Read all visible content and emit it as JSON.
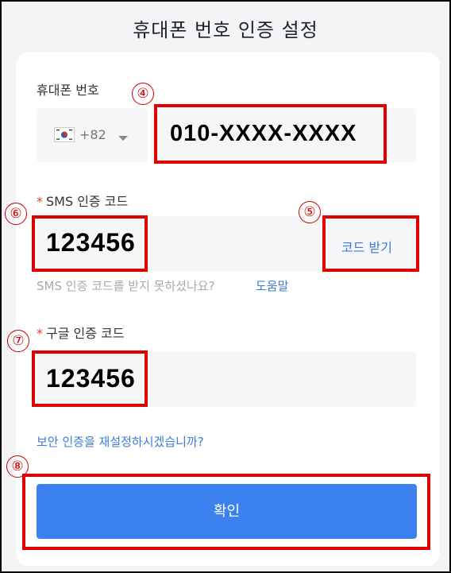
{
  "page": {
    "title": "휴대폰 번호 인증 설정"
  },
  "phone": {
    "label": "휴대폰 번호",
    "country_code": "+82",
    "value": "010-XXXX-XXXX",
    "marker": "④"
  },
  "sms": {
    "required_mark": "*",
    "label": "SMS 인증 코드",
    "value": "123456",
    "get_code_button": "코드 받기",
    "help_text": "SMS 인증 코드를 받지 못하셨나요?",
    "help_link": "도움말",
    "marker": "⑥",
    "button_marker": "⑤"
  },
  "google": {
    "required_mark": "*",
    "label": "구글 인증 코드",
    "value": "123456",
    "marker": "⑦"
  },
  "reset_link": "보안 인증을 재설정하시겠습니까?",
  "confirm": {
    "label": "확인",
    "marker": "⑧"
  },
  "colors": {
    "accent": "#3b82f0",
    "link": "#3d7bd9",
    "highlight": "#e00000",
    "required": "#e53935"
  }
}
